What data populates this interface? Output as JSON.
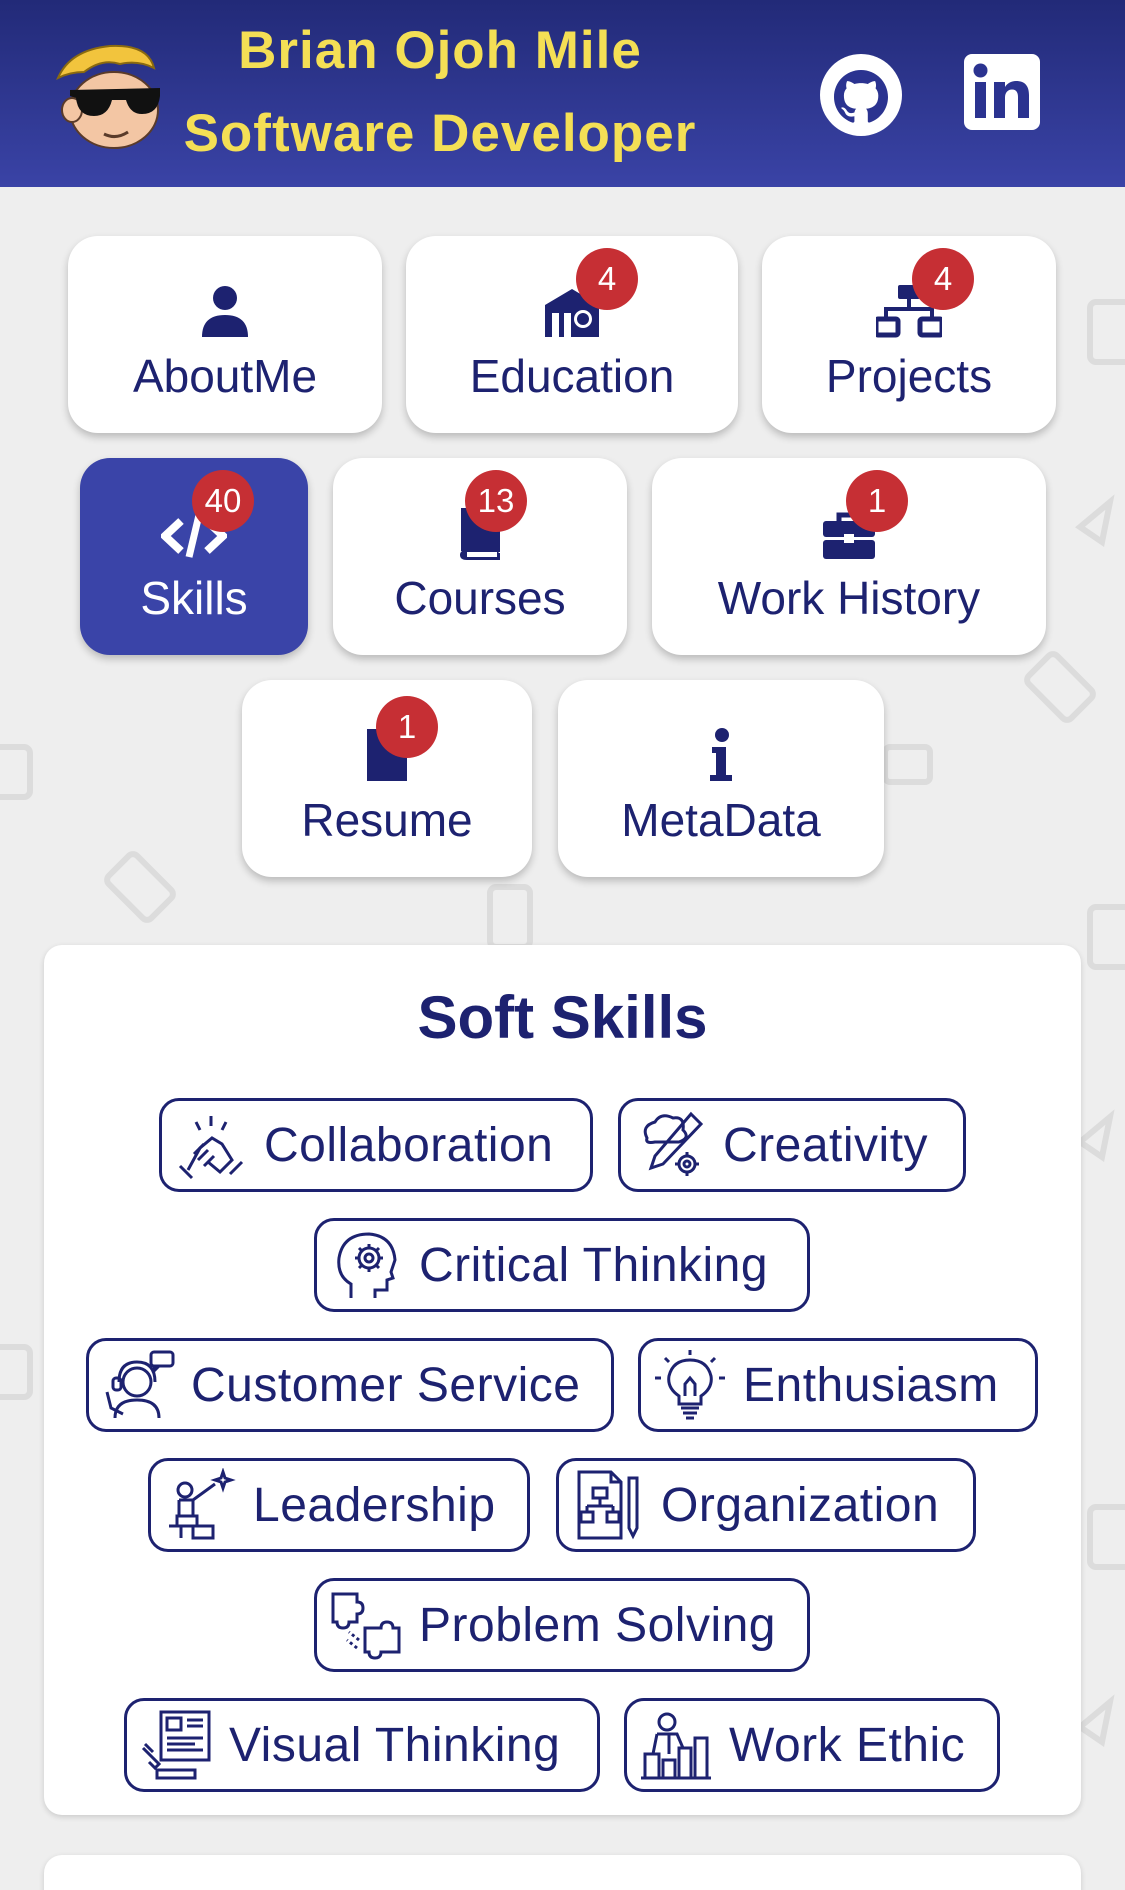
{
  "header": {
    "name": "Brian Ojoh Mile",
    "role": "Software Developer",
    "avatar_icon": "cartoon-avatar-sunglasses-icon",
    "github_icon": "github-icon",
    "linkedin_icon": "linkedin-icon"
  },
  "nav": {
    "about": {
      "label": "AboutMe",
      "icon": "user-icon"
    },
    "education": {
      "label": "Education",
      "badge": "4",
      "icon": "school-icon"
    },
    "projects": {
      "label": "Projects",
      "badge": "4",
      "icon": "sitemap-icon"
    },
    "skills": {
      "label": "Skills",
      "badge": "40",
      "icon": "code-icon",
      "active": true
    },
    "courses": {
      "label": "Courses",
      "badge": "13",
      "icon": "book-icon"
    },
    "work_history": {
      "label": "Work History",
      "badge": "1",
      "icon": "briefcase-icon"
    },
    "resume": {
      "label": "Resume",
      "badge": "1",
      "icon": "file-icon"
    },
    "metadata": {
      "label": "MetaData",
      "icon": "info-icon"
    }
  },
  "soft_skills": {
    "title": "Soft Skills",
    "items": [
      {
        "label": "Collaboration",
        "icon": "handshake-icon"
      },
      {
        "label": "Creativity",
        "icon": "creativity-icon"
      },
      {
        "label": "Critical Thinking",
        "icon": "head-gear-icon"
      },
      {
        "label": "Customer Service",
        "icon": "customer-service-icon"
      },
      {
        "label": "Enthusiasm",
        "icon": "lightbulb-icon"
      },
      {
        "label": "Leadership",
        "icon": "leadership-icon"
      },
      {
        "label": "Organization",
        "icon": "organization-icon"
      },
      {
        "label": "Problem Solving",
        "icon": "puzzle-icon"
      },
      {
        "label": "Visual Thinking",
        "icon": "visual-thinking-icon"
      },
      {
        "label": "Work Ethic",
        "icon": "work-ethic-icon"
      }
    ]
  },
  "colors": {
    "header_bg": "#2b3390",
    "header_text": "#f4df55",
    "primary": "#1d2270",
    "active": "#3a44a8",
    "badge": "#c62f34",
    "page_bg": "#eeeeee"
  }
}
